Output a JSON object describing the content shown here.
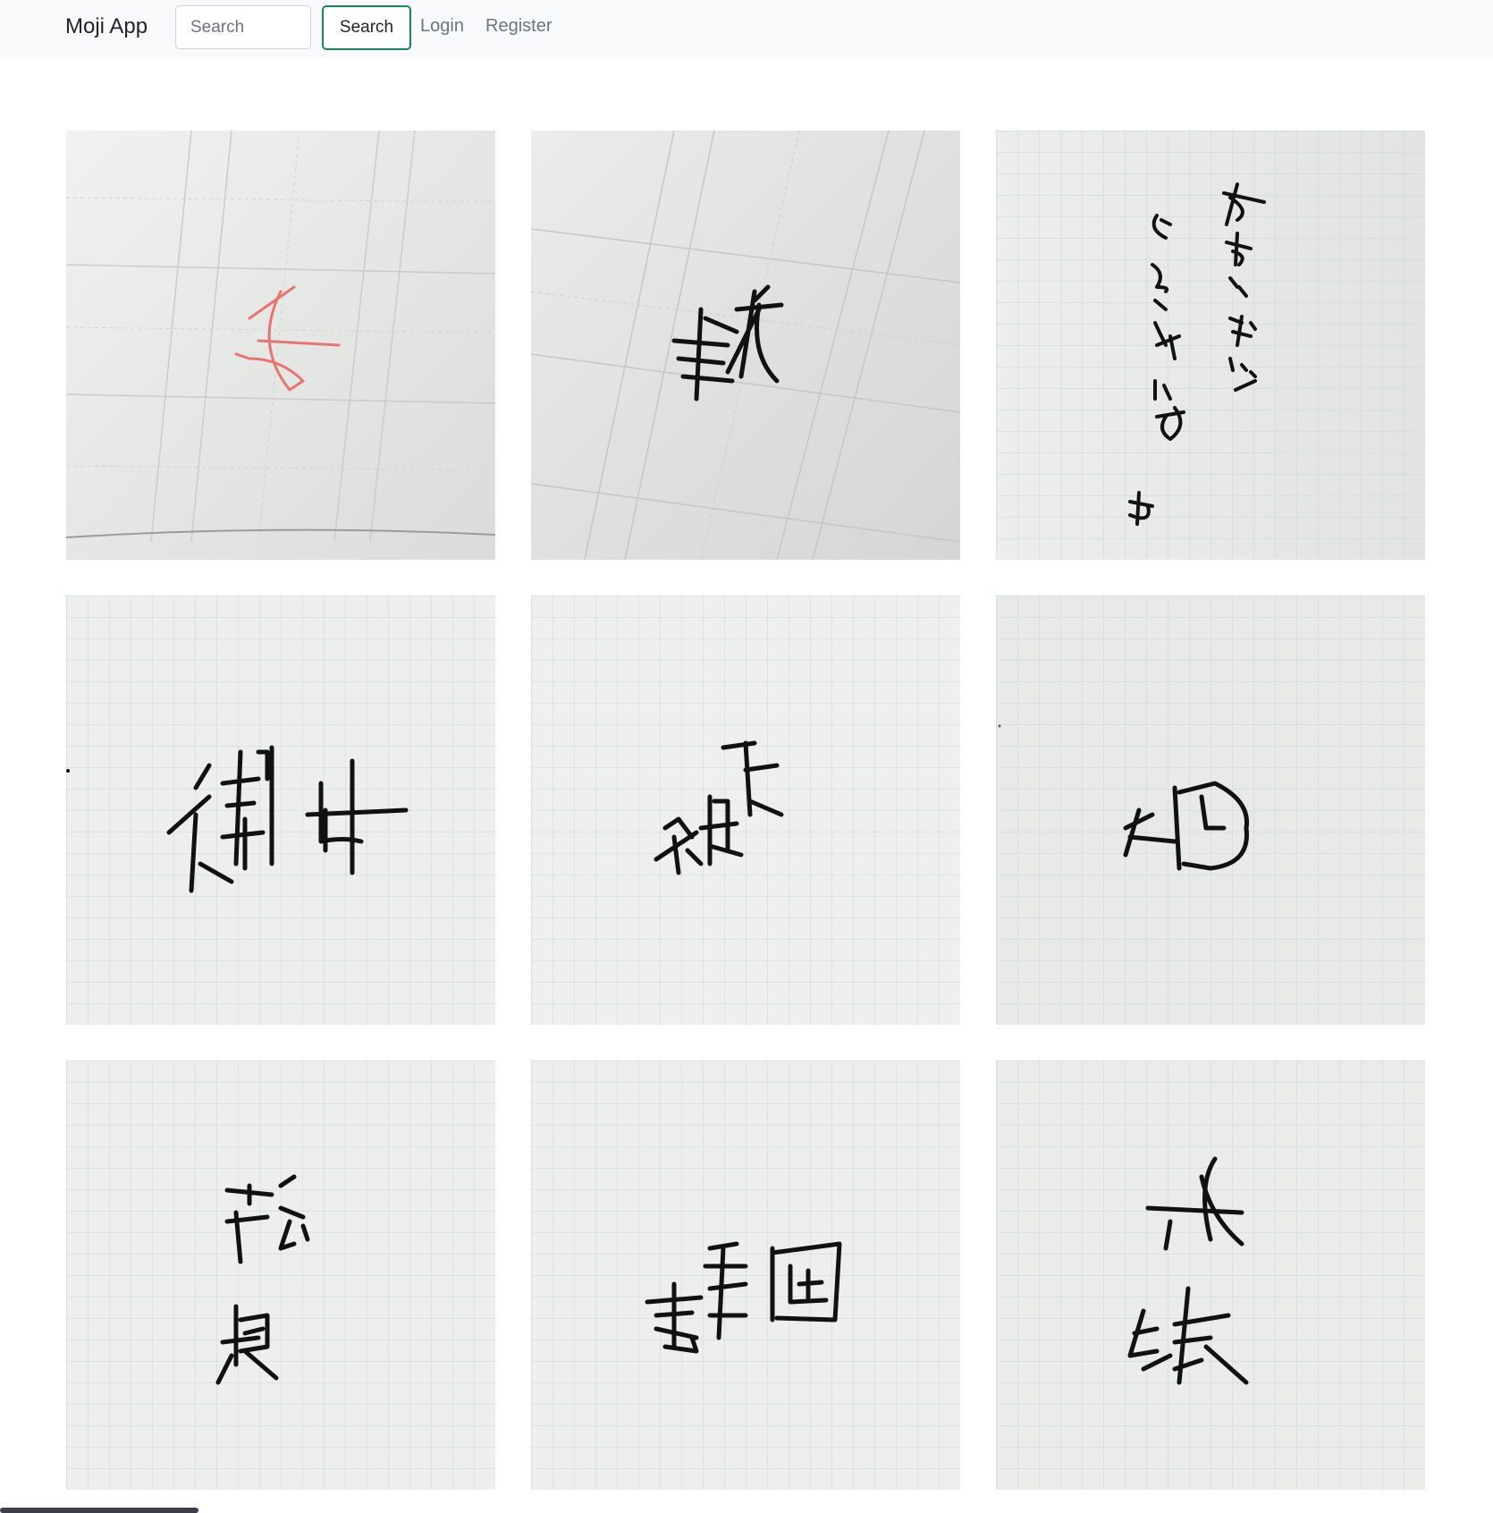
{
  "navbar": {
    "brand": "Moji App",
    "search": {
      "placeholder": "Search",
      "value": ""
    },
    "search_button": "Search",
    "links": {
      "login": "Login",
      "register": "Register"
    }
  },
  "gallery": {
    "columns": 3,
    "tiles": [
      {
        "paper": "lined",
        "ink": "red"
      },
      {
        "paper": "lined",
        "ink": "black"
      },
      {
        "paper": "grid",
        "ink": "black"
      },
      {
        "paper": "grid",
        "ink": "black"
      },
      {
        "paper": "grid",
        "ink": "black"
      },
      {
        "paper": "grid",
        "ink": "black"
      },
      {
        "paper": "grid",
        "ink": "black"
      },
      {
        "paper": "grid",
        "ink": "black"
      },
      {
        "paper": "grid",
        "ink": "black"
      }
    ]
  },
  "colors": {
    "navbar_bg": "#f8f9fa",
    "button_border": "#198754",
    "link": "#6c757d",
    "grid_line": "#a9d8dc",
    "red_ink": "#e8746f"
  }
}
